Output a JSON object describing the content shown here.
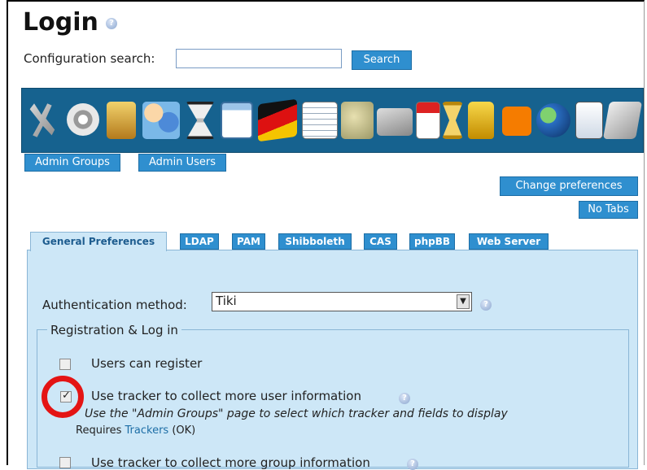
{
  "page": {
    "title": "Login"
  },
  "config_search": {
    "label": "Configuration search:",
    "value": "",
    "button": "Search"
  },
  "icon_toolbar": {
    "icons": [
      "tools-icon",
      "power-icon",
      "login-icon",
      "users-icon",
      "hourglass-icon",
      "window-icon",
      "flag-icon",
      "notepad-icon",
      "puzzle-icon",
      "mail-icon",
      "calendar-icon",
      "timer-icon",
      "lock-icon",
      "rss-icon",
      "globe-icon",
      "document-icon",
      "stack-icon",
      "edit-icon"
    ]
  },
  "admin_links": {
    "groups": "Admin Groups",
    "users": "Admin Users"
  },
  "actions": {
    "change_preferences": "Change preferences",
    "no_tabs": "No Tabs"
  },
  "tabs": [
    {
      "label": "General Preferences",
      "active": true
    },
    {
      "label": "LDAP"
    },
    {
      "label": "PAM"
    },
    {
      "label": "Shibboleth"
    },
    {
      "label": "CAS"
    },
    {
      "label": "phpBB"
    },
    {
      "label": "Web Server"
    }
  ],
  "auth": {
    "label": "Authentication method:",
    "value": "Tiki"
  },
  "registration": {
    "legend": "Registration & Log in",
    "options": [
      {
        "label": "Users can register",
        "checked": false
      },
      {
        "label": "Use tracker to collect more user information",
        "checked": true
      },
      {
        "label": "Use tracker to collect more group information",
        "checked": false
      }
    ],
    "hint": "Use the \"Admin Groups\" page to select which tracker and fields to display",
    "requires_prefix": "Requires",
    "requires_link": "Trackers",
    "requires_suffix": "(OK)"
  },
  "colors": {
    "accent": "#2f8fcf",
    "panel": "#cde7f7",
    "toolbar": "#16628f",
    "highlight_ring": "#e41414"
  }
}
